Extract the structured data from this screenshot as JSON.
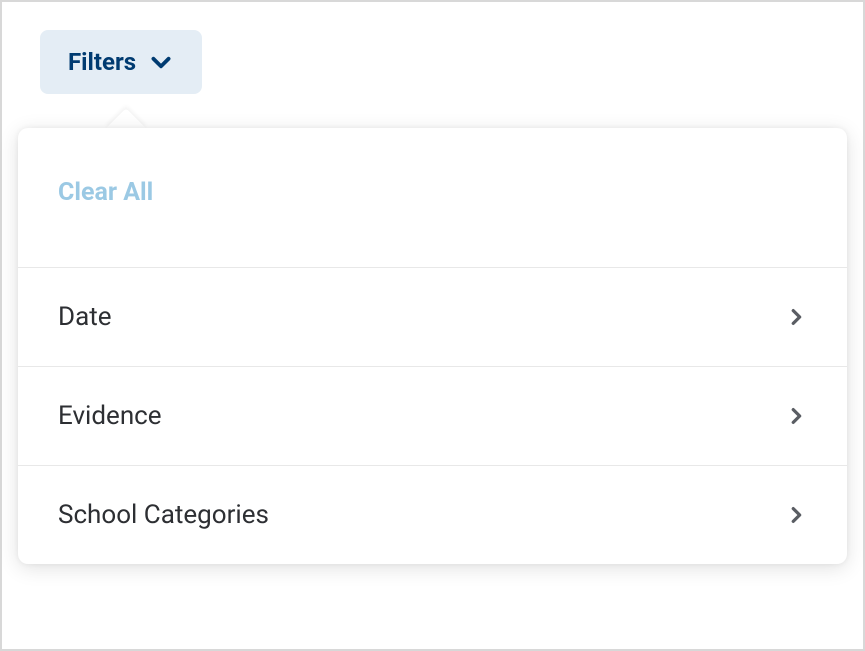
{
  "filters_button": {
    "label": "Filters"
  },
  "clear_all": {
    "label": "Clear All"
  },
  "filter_items": [
    {
      "label": "Date"
    },
    {
      "label": "Evidence"
    },
    {
      "label": "School Categories"
    }
  ]
}
